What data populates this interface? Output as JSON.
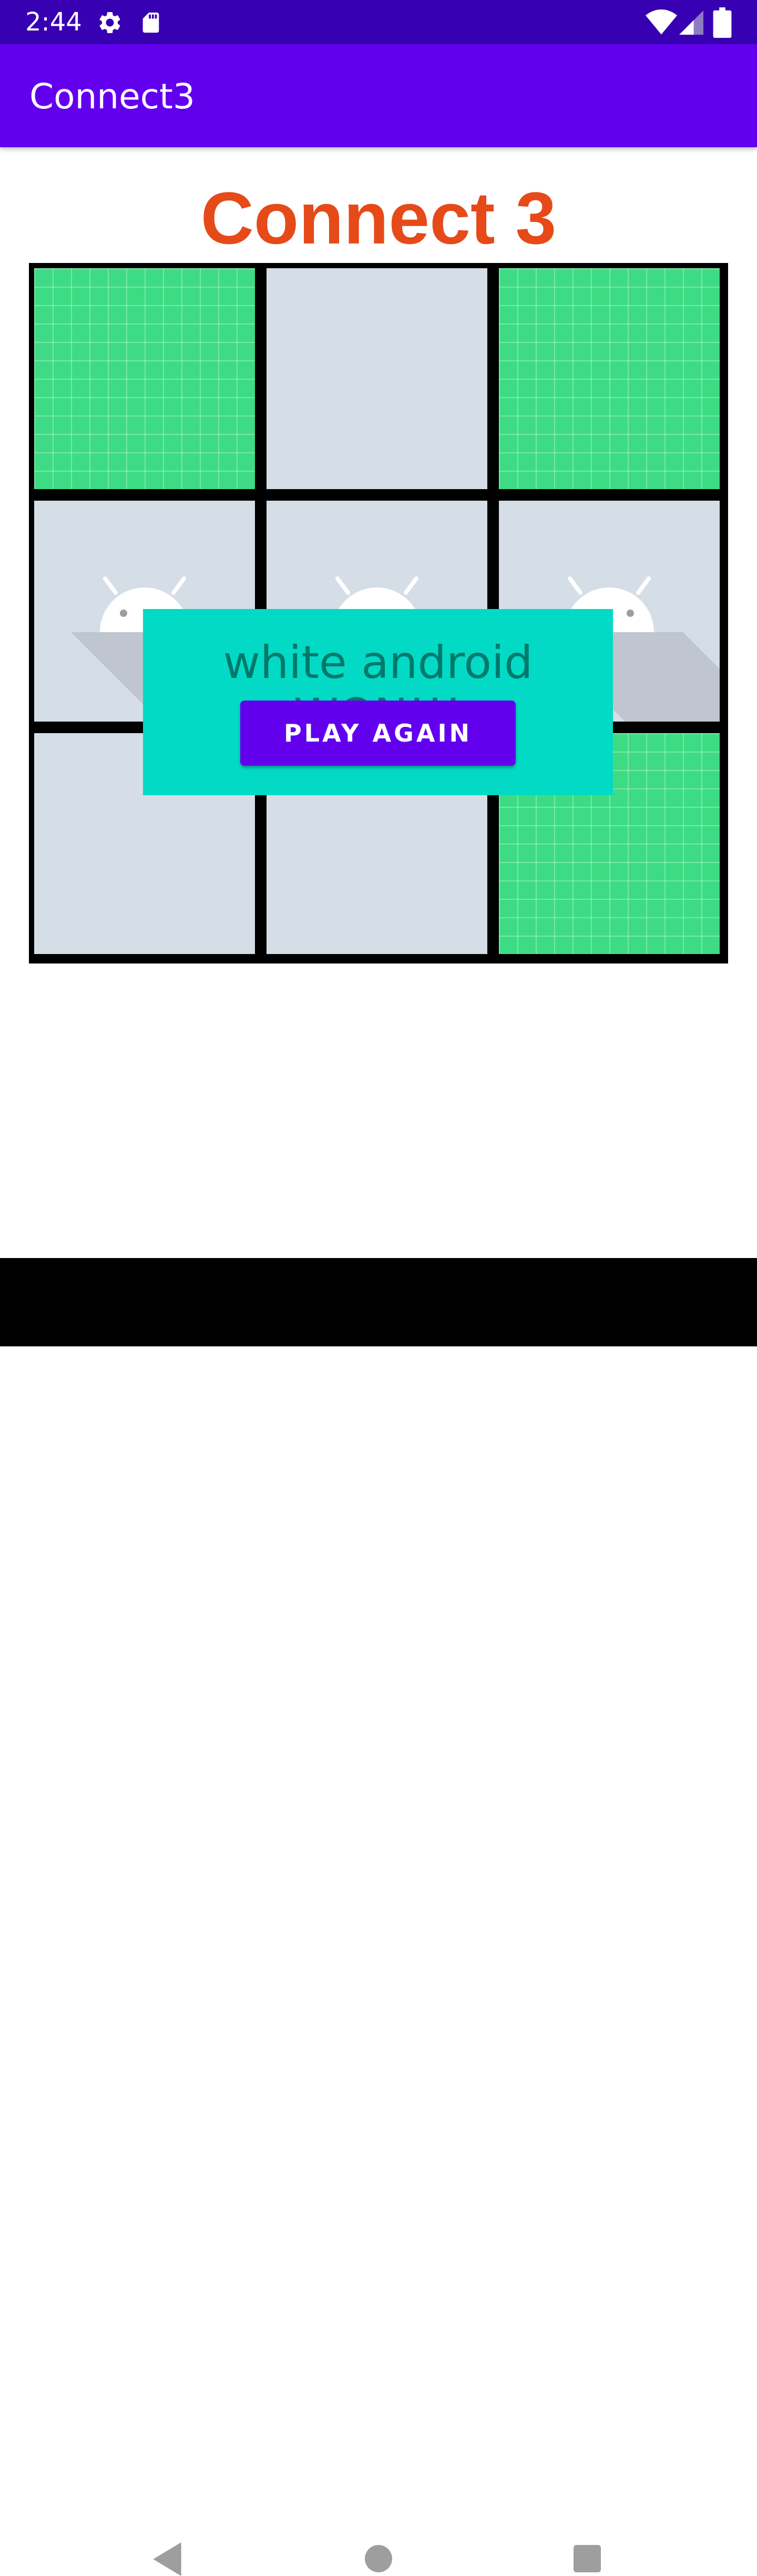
{
  "status_bar": {
    "time": "2:44",
    "icons": [
      "settings-icon",
      "sd-card-icon",
      "wifi-icon",
      "signal-icon",
      "battery-icon"
    ]
  },
  "app_bar": {
    "title": "Connect3"
  },
  "game": {
    "title": "Connect 3",
    "board": [
      {
        "state": "win"
      },
      {
        "state": "empty"
      },
      {
        "state": "win"
      },
      {
        "state": "android"
      },
      {
        "state": "android"
      },
      {
        "state": "android"
      },
      {
        "state": "empty"
      },
      {
        "state": "empty"
      },
      {
        "state": "win"
      }
    ]
  },
  "overlay": {
    "message": "white android WON!!!",
    "button_label": "PLAY AGAIN"
  },
  "nav": {
    "icons": [
      "back-icon",
      "home-icon",
      "recents-icon"
    ]
  },
  "colors": {
    "status_bar": "#3700b3",
    "app_bar": "#6200ee",
    "title": "#e64a19",
    "win_cell": "#3ddc84",
    "empty_cell": "#d5dde6",
    "overlay": "#03dac6",
    "message": "#00796b"
  }
}
